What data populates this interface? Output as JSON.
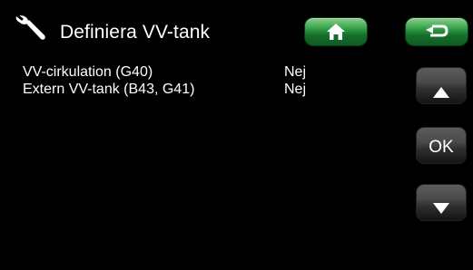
{
  "header": {
    "title": "Definiera VV-tank",
    "icons": {
      "settings": "wrench-icon",
      "home": "home-icon",
      "back": "return-arrow-icon"
    }
  },
  "settings_list": [
    {
      "label": "VV-cirkulation (G40)",
      "value": "Nej"
    },
    {
      "label": "Extern VV-tank (B43, G41)",
      "value": "Nej"
    }
  ],
  "nav": {
    "up_icon": "arrow-up-icon",
    "ok_label": "OK",
    "down_icon": "arrow-down-icon"
  },
  "colors": {
    "background": "#000000",
    "text": "#ffffff",
    "accent_green": "#2a8a3c",
    "button_gray": "#4a4a4a"
  }
}
